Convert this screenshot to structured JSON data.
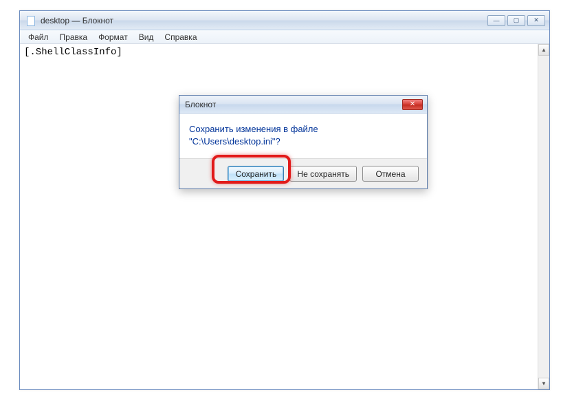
{
  "window": {
    "title": "desktop — Блокнот"
  },
  "menu": {
    "file": "Файл",
    "edit": "Правка",
    "format": "Формат",
    "view": "Вид",
    "help": "Справка"
  },
  "editor": {
    "content": "[.ShellClassInfo]"
  },
  "dialog": {
    "title": "Блокнот",
    "message_line1": "Сохранить изменения в файле",
    "message_line2": "\"C:\\Users\\desktop.ini\"?",
    "save": "Сохранить",
    "dontsave": "Не сохранять",
    "cancel": "Отмена"
  }
}
